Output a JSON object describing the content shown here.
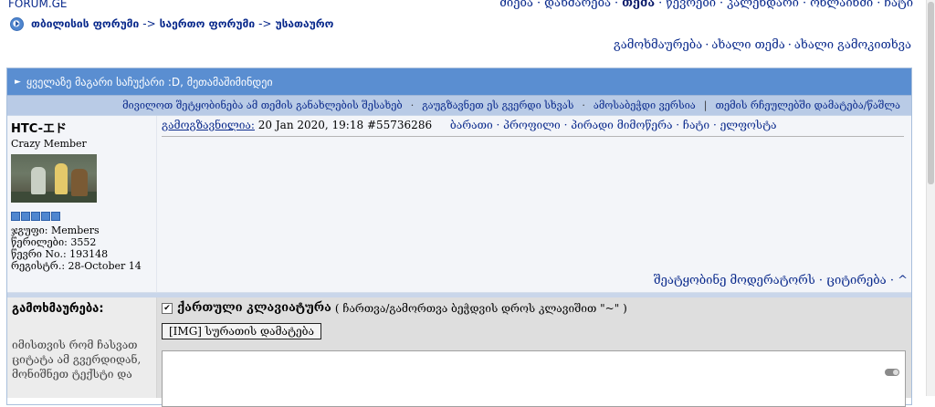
{
  "site": {
    "brand": "FORUM.GE"
  },
  "top_nav": {
    "items": [
      "ძიება",
      "დახმარება",
      "თემა",
      "წევრები",
      "კალენდარი",
      "ონლაინში",
      "ჩატი"
    ],
    "active_index": 2
  },
  "breadcrumb": {
    "items": [
      "თბილისის ფორუმი",
      "საერთო ფორუმი",
      "უსათაურო"
    ],
    "separator": "->"
  },
  "actions": [
    "გამოხმაურება",
    "ახალი თემა",
    "ახალი გამოკითხვა"
  ],
  "topic": {
    "title": "ყველაზე მაგარი საჩუქარი :D, მეთამაშიმინდეი",
    "options": [
      "მივილოთ შეტყობინება ამ თემის განახლების შესახებ",
      "გაუგზავნეთ ეს გვერდი სხვას",
      "ამოსაბეჭდი ვერსია",
      "თემის რჩეულებში დამატება/წაშლა"
    ],
    "options_dot": "·",
    "options_last_sep": "|"
  },
  "post": {
    "author": {
      "name": "HTC-エド",
      "title": "Crazy Member",
      "group": "ჯგუფი: Members",
      "posts": "წერილები: 3552",
      "member_no": "წევრი No.: 193148",
      "registered": "რეგისტრ.: 28-October 14",
      "rank_pips": 5
    },
    "meta": {
      "sent_label": "გამოგზავნილია:",
      "date": "20 Jan 2020, 19:18",
      "id": "#55736286"
    },
    "links": [
      "ბარათი",
      "პროფილი",
      "პირადი მიმოწერა",
      "ჩატი",
      "ელფოსტა"
    ],
    "footer": {
      "report": "შეატყობინე მოდერატორს",
      "quote": "ციტირება",
      "up": "^"
    }
  },
  "reply": {
    "title": "გამოხმაურება:",
    "help": "იმისთვის რომ ჩასვათ ციტატა ამ გვერდიდან, მონიშნეთ ტექსტი და",
    "keyboard_label": "ქართული კლავიატურა",
    "keyboard_hint": "( ჩართვა/გამორთვა ბეჭდვის დროს კლავიშით \"~\" )",
    "keyboard_checked": true,
    "img_button": "[IMG] სურათის დამატება"
  },
  "colors": {
    "header_bar": "#5a8ed1",
    "options_bar": "#b9cbe6",
    "link": "#0a2a8c"
  }
}
